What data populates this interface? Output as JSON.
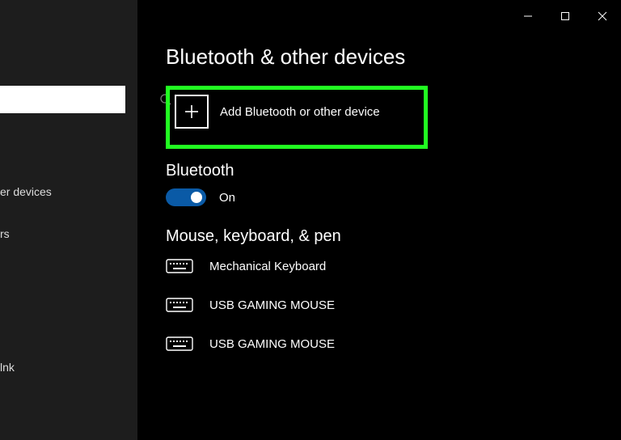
{
  "titlebar": {
    "minimize_name": "minimize-icon",
    "maximize_name": "maximize-icon",
    "close_name": "close-icon"
  },
  "sidebar": {
    "search_placeholder": "",
    "items": [
      {
        "label": "er devices"
      },
      {
        "label": "rs"
      },
      {
        "label": "lnk"
      }
    ]
  },
  "page": {
    "title": "Bluetooth & other devices"
  },
  "add": {
    "label": "Add Bluetooth or other device"
  },
  "bluetooth": {
    "heading": "Bluetooth",
    "state_label": "On",
    "on": true
  },
  "mkp": {
    "heading": "Mouse, keyboard, & pen",
    "devices": [
      {
        "label": "Mechanical Keyboard"
      },
      {
        "label": "USB GAMING MOUSE"
      },
      {
        "label": "USB GAMING MOUSE"
      }
    ]
  },
  "colors": {
    "highlight": "#21ff21",
    "toggle_on": "#0a5aa6"
  }
}
